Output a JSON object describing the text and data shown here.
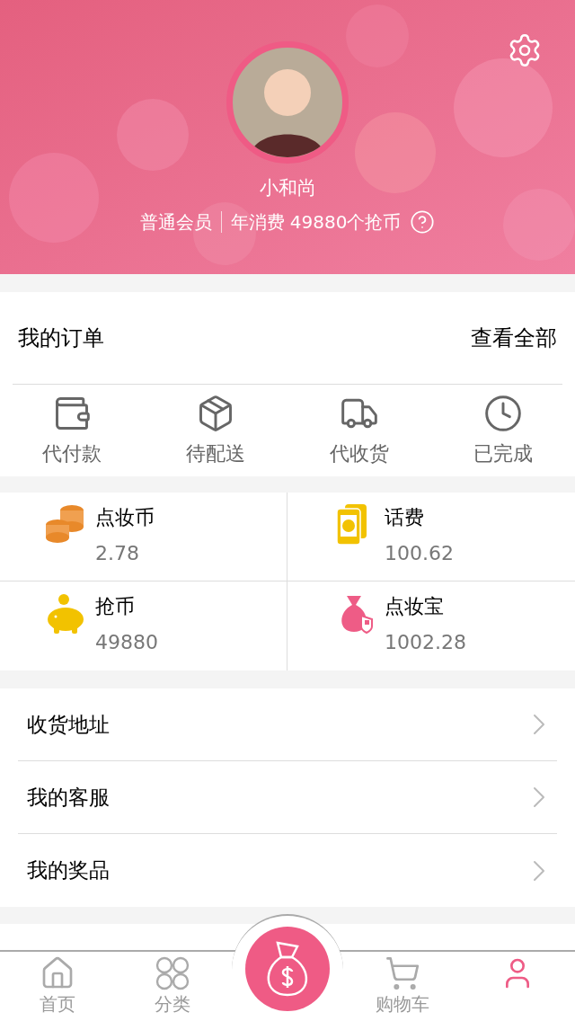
{
  "profile": {
    "name": "小和尚",
    "level": "普通会员",
    "spending": "年消费 49880个抢币"
  },
  "orders": {
    "title": "我的订单",
    "view_all": "查看全部",
    "statuses": [
      {
        "kind": "wallet",
        "label": "代付款"
      },
      {
        "kind": "box",
        "label": "待配送"
      },
      {
        "kind": "truck",
        "label": "代收货"
      },
      {
        "kind": "clock",
        "label": "已完成"
      }
    ]
  },
  "assets": [
    {
      "kind": "coins",
      "label": "点妆币",
      "value": "2.78"
    },
    {
      "kind": "phone",
      "label": "话费",
      "value": "100.62"
    },
    {
      "kind": "piggy",
      "label": "抢币",
      "value": "49880"
    },
    {
      "kind": "bag",
      "label": "点妆宝",
      "value": "1002.28"
    }
  ],
  "menu": [
    {
      "label": "收货地址"
    },
    {
      "label": "我的客服"
    },
    {
      "label": "我的奖品"
    }
  ],
  "tab_bar": [
    {
      "kind": "home",
      "label": "首页",
      "selected": false
    },
    {
      "kind": "grid",
      "label": "分类",
      "selected": false
    },
    {
      "kind": "center",
      "selected": false
    },
    {
      "kind": "cart",
      "label": "购物车",
      "selected": false
    },
    {
      "kind": "person",
      "selected": true
    }
  ]
}
